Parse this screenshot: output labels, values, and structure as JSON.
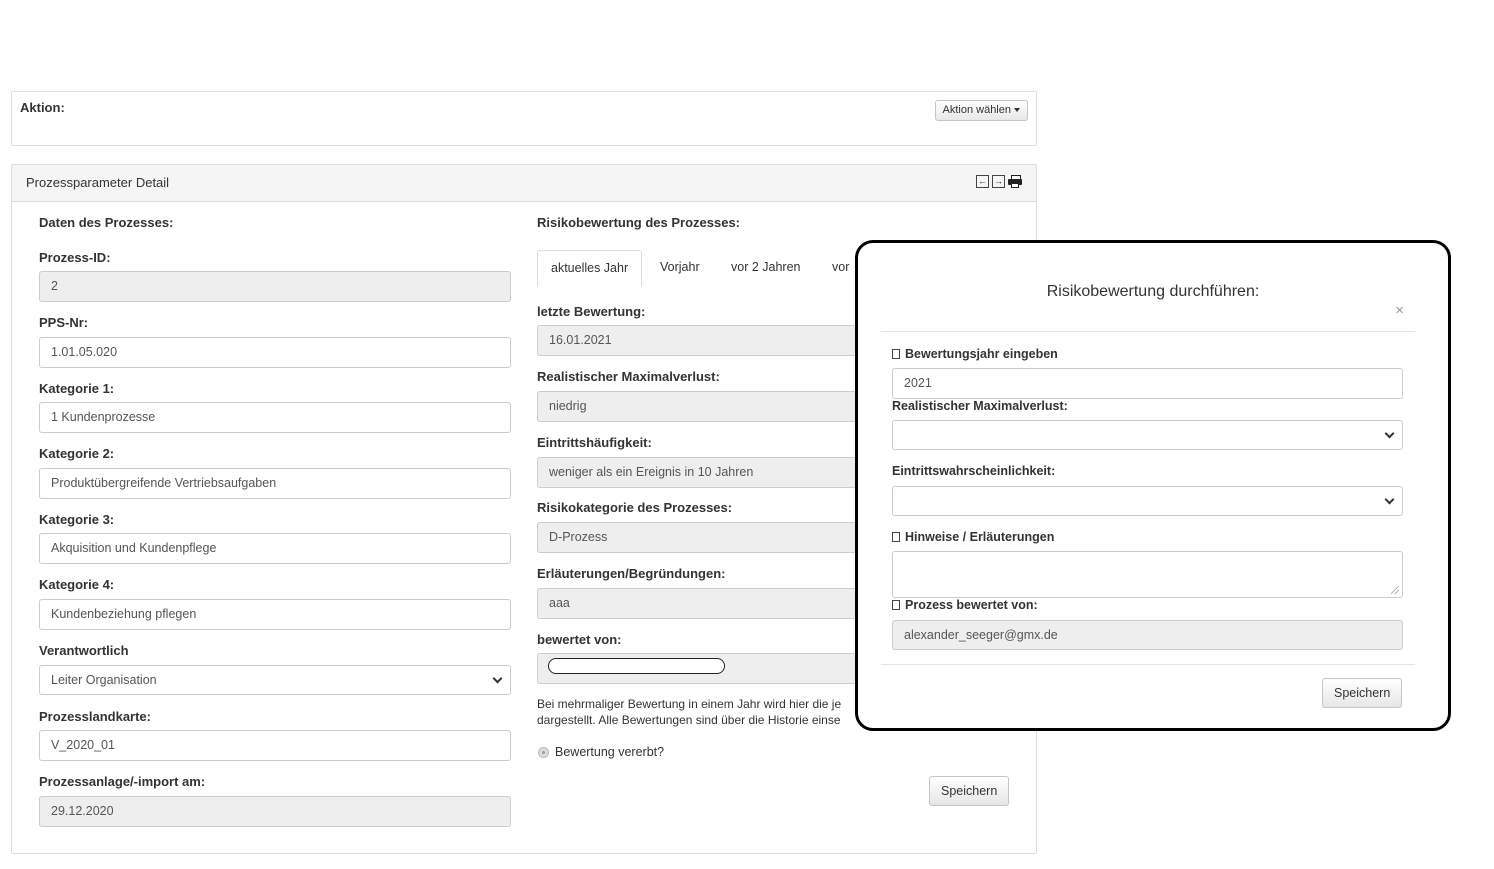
{
  "action_panel": {
    "label": "Aktion:",
    "button_label": "Aktion wählen"
  },
  "detail": {
    "title": "Prozessparameter Detail",
    "left": {
      "section_title": "Daten des Prozesses:",
      "fields": [
        {
          "label": "Prozess-ID:",
          "value": "2",
          "readonly": true
        },
        {
          "label": "PPS-Nr:",
          "value": "1.01.05.020",
          "readonly": false
        },
        {
          "label": "Kategorie 1:",
          "value": "1 Kundenprozesse",
          "readonly": false
        },
        {
          "label": "Kategorie 2:",
          "value": "Produktübergreifende Vertriebsaufgaben",
          "readonly": false
        },
        {
          "label": "Kategorie 3:",
          "value": "Akquisition und Kundenpflege",
          "readonly": false
        },
        {
          "label": "Kategorie 4:",
          "value": "Kundenbeziehung pflegen",
          "readonly": false
        },
        {
          "label": "Verantwortlich",
          "value": "Leiter Organisation",
          "readonly": false,
          "type": "select"
        },
        {
          "label": "Prozesslandkarte:",
          "value": "V_2020_01",
          "readonly": false
        },
        {
          "label": "Prozessanlage/-import am:",
          "value": "29.12.2020",
          "readonly": true
        }
      ]
    },
    "right": {
      "section_title": "Risikobewertung des Prozesses:",
      "tabs": [
        "aktuelles Jahr",
        "Vorjahr",
        "vor 2 Jahren",
        "vor"
      ],
      "fields": [
        {
          "label": "letzte Bewertung:",
          "value": "16.01.2021"
        },
        {
          "label": "Realistischer Maximalverlust:",
          "value": "niedrig"
        },
        {
          "label": "Eintrittshäufigkeit:",
          "value": "weniger als ein Ereignis in 10 Jahren"
        },
        {
          "label": "Risikokategorie des Prozesses:",
          "value": "D-Prozess"
        },
        {
          "label": "Erläuterungen/Begründungen:",
          "value": "aaa"
        },
        {
          "label": "bewertet von:",
          "value": ""
        }
      ],
      "hint_line1": "Bei mehrmaliger Bewertung in einem Jahr wird hier die je",
      "hint_line2": "dargestellt. Alle Bewertungen sind über die Historie einse",
      "inherit_label": "Bewertung vererbt?",
      "save_label": "Speichern"
    }
  },
  "modal": {
    "title": "Risikobewertung durchführen:",
    "close": "×",
    "year_label": "Bewertungsjahr eingeben",
    "year_value": "2021",
    "loss_label": "Realistischer Maximalverlust:",
    "loss_value": "",
    "prob_label": "Eintrittswahrscheinlichkeit:",
    "prob_value": "",
    "notes_label": "Hinweise / Erläuterungen",
    "notes_value": "",
    "rated_by_label": "Prozess bewertet von:",
    "rated_by_value": "alexander_seeger@gmx.de",
    "save_label": "Speichern"
  }
}
